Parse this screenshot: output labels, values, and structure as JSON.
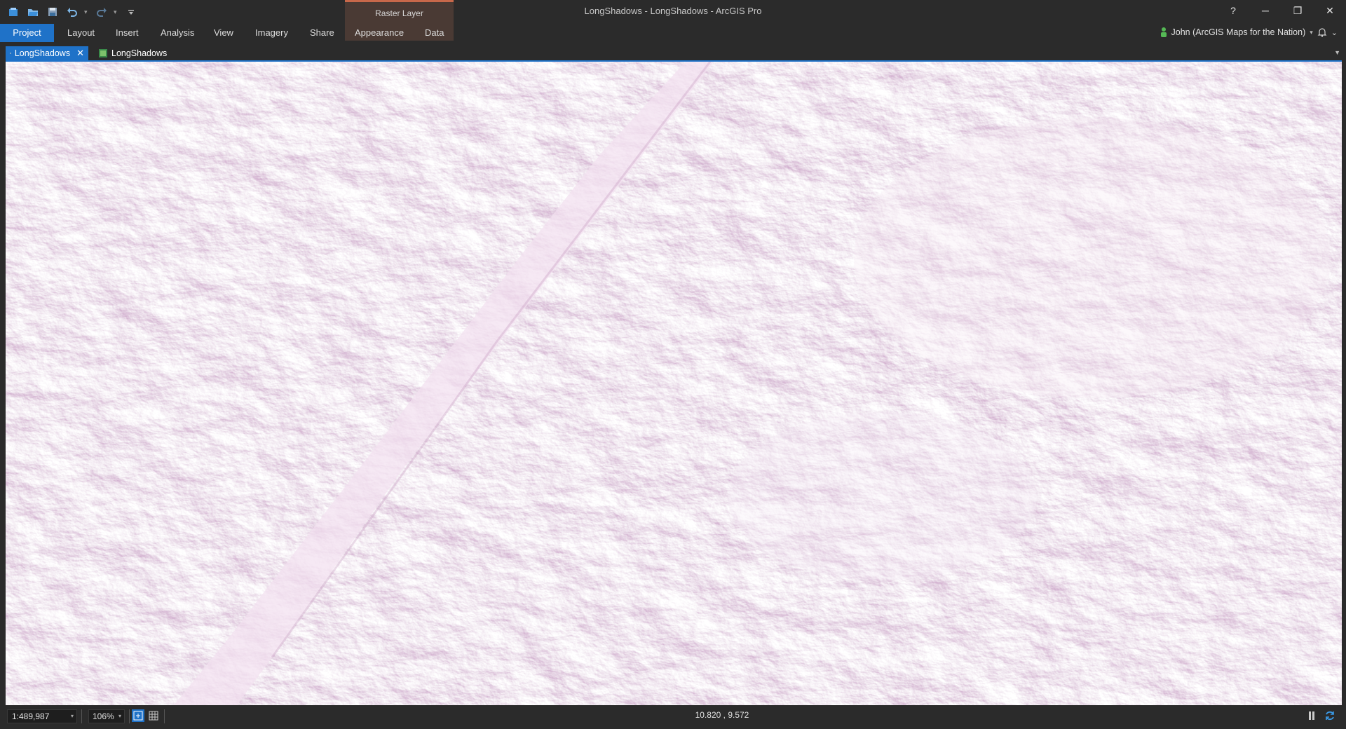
{
  "window": {
    "title": "LongShadows - LongShadows - ArcGIS Pro",
    "controls": {
      "help": "?",
      "minimize": "─",
      "restore": "❐",
      "close": "✕"
    }
  },
  "quick_access": {
    "icons": [
      "new-project-icon",
      "open-project-icon",
      "save-project-icon",
      "undo-icon",
      "redo-icon",
      "customize-icon"
    ]
  },
  "contextual_tab": {
    "label": "Raster Layer"
  },
  "ribbon": {
    "tabs": [
      {
        "label": "Project",
        "active": true
      },
      {
        "label": "Layout"
      },
      {
        "label": "Insert"
      },
      {
        "label": "Analysis"
      },
      {
        "label": "View"
      },
      {
        "label": "Imagery"
      },
      {
        "label": "Share"
      },
      {
        "label": "Appearance"
      },
      {
        "label": "Data"
      }
    ]
  },
  "user": {
    "label": "John (ArcGIS Maps for the Nation)",
    "status_color": "#55b955"
  },
  "document_tabs": [
    {
      "label": "LongShadows",
      "active": true,
      "icon": "map-icon"
    },
    {
      "label": "LongShadows",
      "active": false,
      "icon": "raster-icon"
    }
  ],
  "map": {
    "content": "multidirectional hillshade raster",
    "colors": {
      "base": "#f3e6f1",
      "shadow": "#a2689a",
      "highlight": "#ffffff"
    }
  },
  "status_bar": {
    "scale": "1:489,987",
    "zoom": "106%",
    "coordinates": "10.820 , 9.572"
  },
  "accent_color": "#1f72c8"
}
